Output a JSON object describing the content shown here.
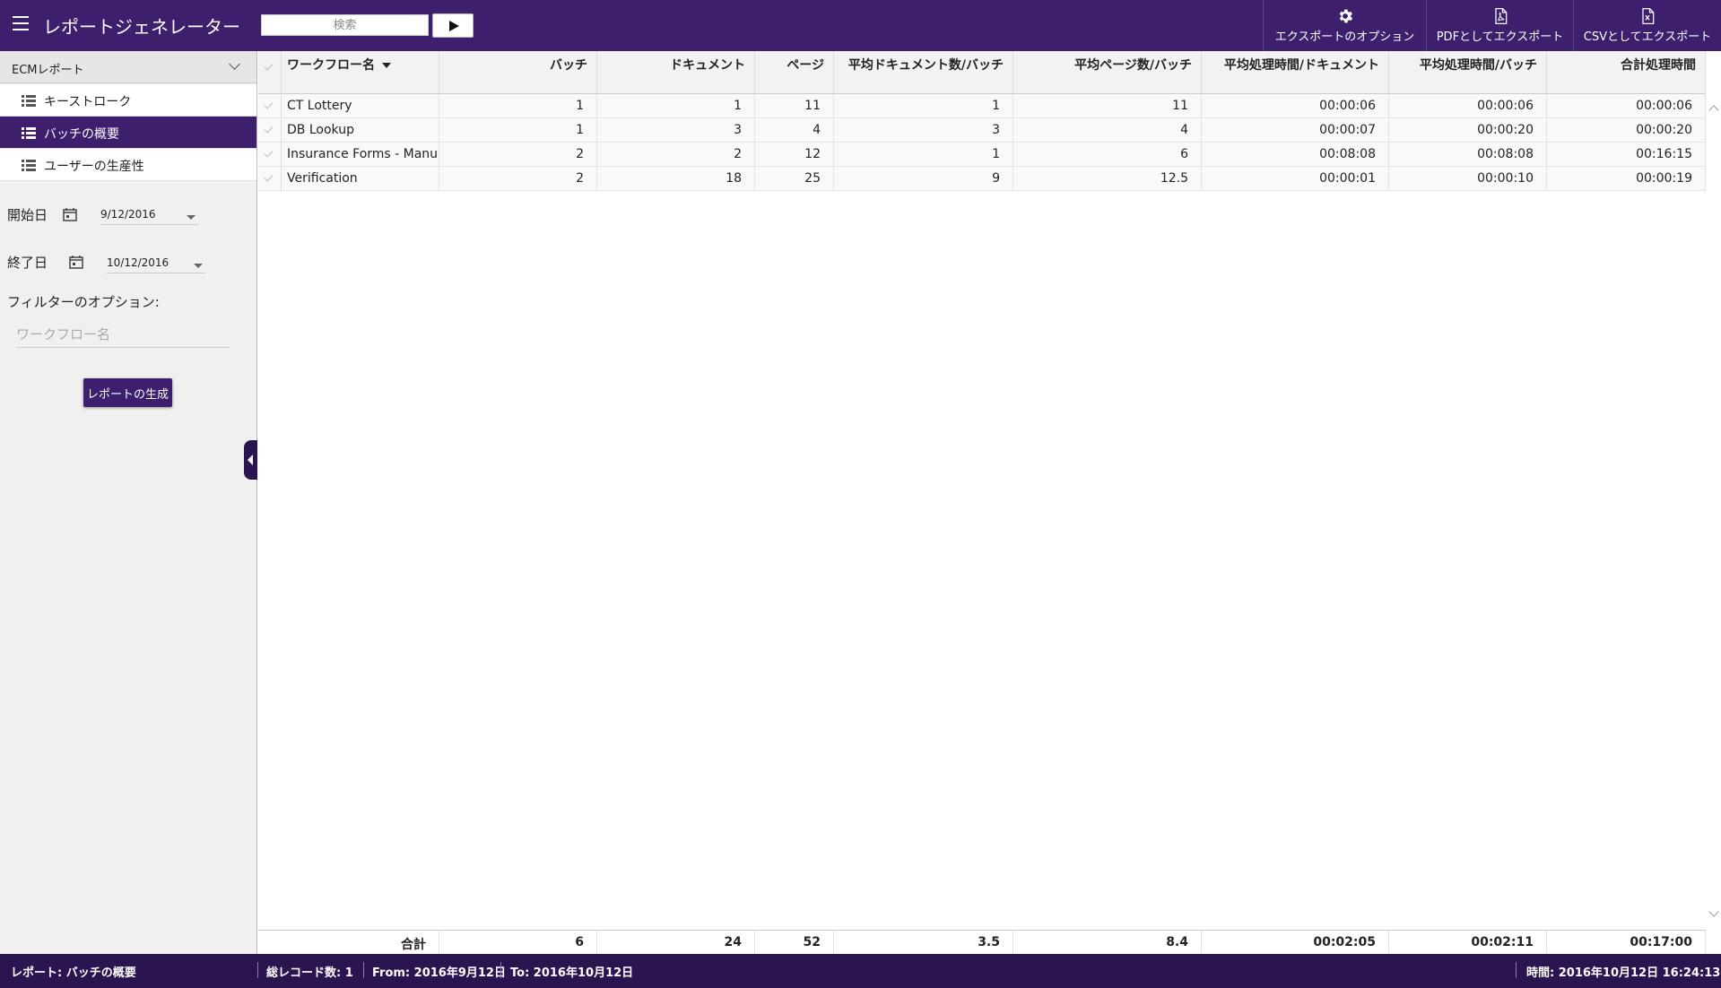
{
  "header": {
    "title": "レポートジェネレーター",
    "search_placeholder": "検索",
    "export_options": "エクスポートのオプション",
    "export_pdf": "PDFとしてエクスポート",
    "export_csv": "CSVとしてエクスポート"
  },
  "sidebar": {
    "dropdown": "ECMレポート",
    "items": [
      {
        "label": "キーストローク"
      },
      {
        "label": "バッチの概要"
      },
      {
        "label": "ユーザーの生産性"
      }
    ],
    "start_label": "開始日",
    "start_value": "9/12/2016",
    "end_label": "終了日",
    "end_value": "10/12/2016",
    "filter_title": "フィルターのオプション:",
    "filter_placeholder": "ワークフロー名",
    "generate_label": "レポートの生成"
  },
  "grid": {
    "columns": [
      "ワークフロー名",
      "バッチ",
      "ドキュメント",
      "ページ",
      "平均ドキュメント数/バッチ",
      "平均ページ数/バッチ",
      "平均処理時間/ドキュメント",
      "平均処理時間/バッチ",
      "合計処理時間"
    ],
    "rows": [
      [
        "CT Lottery",
        "1",
        "1",
        "11",
        "1",
        "11",
        "00:00:06",
        "00:00:06",
        "00:00:06"
      ],
      [
        "DB Lookup",
        "1",
        "3",
        "4",
        "3",
        "4",
        "00:00:07",
        "00:00:20",
        "00:00:20"
      ],
      [
        "Insurance Forms - Manu...",
        "2",
        "2",
        "12",
        "1",
        "6",
        "00:08:08",
        "00:08:08",
        "00:16:15"
      ],
      [
        "Verification",
        "2",
        "18",
        "25",
        "9",
        "12.5",
        "00:00:01",
        "00:00:10",
        "00:00:19"
      ]
    ],
    "totals": [
      "合計",
      "6",
      "24",
      "52",
      "3.5",
      "8.4",
      "00:02:05",
      "00:02:11",
      "00:17:00"
    ]
  },
  "status": {
    "report": "レポート:  バッチの概要",
    "records": "総レコード数:  1",
    "from": "From:  2016年9月12日",
    "to": "To:  2016年10月12日",
    "time": "時間:  2016年10月12日 16:24:13"
  }
}
